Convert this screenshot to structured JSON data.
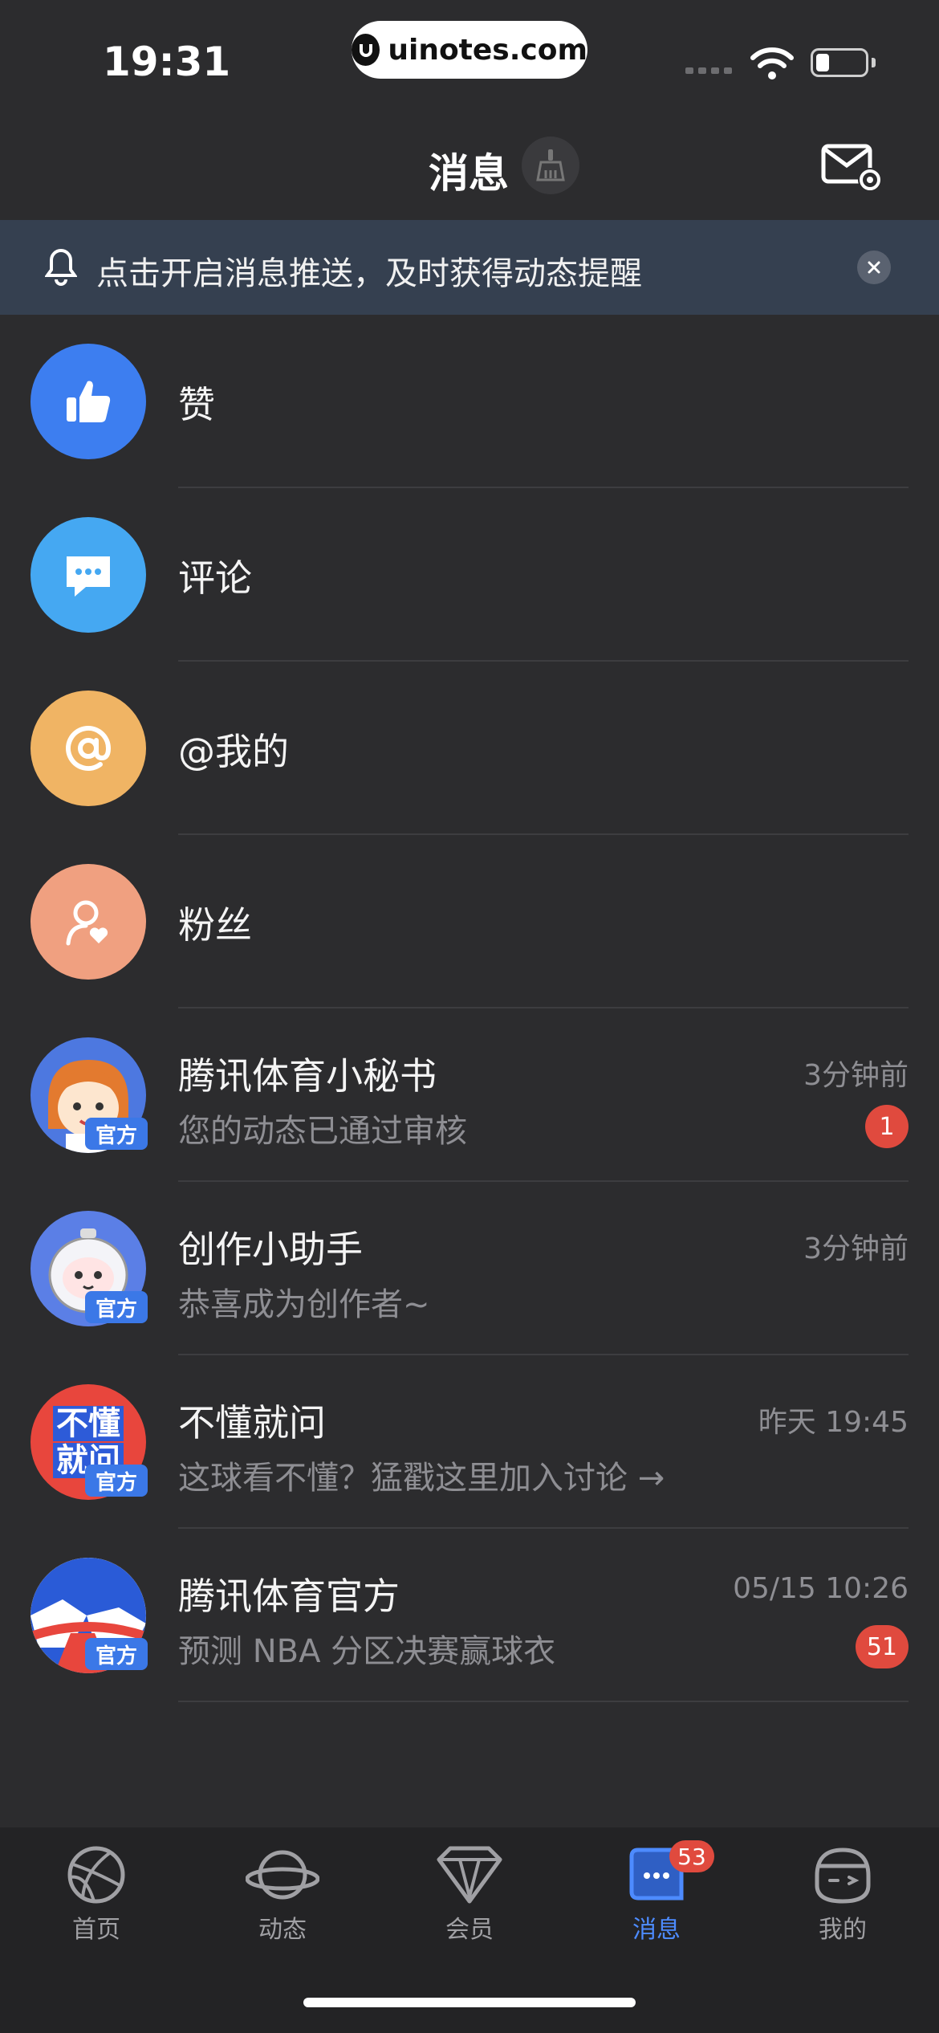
{
  "status_bar": {
    "time": "19:31",
    "url": "uinotes.com"
  },
  "header": {
    "title": "消息"
  },
  "banner": {
    "text": "点击开启消息推送，及时获得动态提醒"
  },
  "categories": [
    {
      "label": "赞",
      "icon": "thumbs-up-icon",
      "color": "#3d7ef0"
    },
    {
      "label": "评论",
      "icon": "comment-icon",
      "color": "#45a8f2"
    },
    {
      "label": "@我的",
      "icon": "at-icon",
      "color": "#f0b464"
    },
    {
      "label": "粉丝",
      "icon": "fans-icon",
      "color": "#f0a080"
    }
  ],
  "chats": [
    {
      "title": "腾讯体育小秘书",
      "preview": "您的动态已通过审核",
      "time": "3分钟前",
      "badge": "1",
      "tag": "官方"
    },
    {
      "title": "创作小助手",
      "preview": "恭喜成为创作者~",
      "time": "3分钟前",
      "badge": "",
      "tag": "官方"
    },
    {
      "title": "不懂就问",
      "preview": "这球看不懂？猛戳这里加入讨论 →",
      "time": "昨天 19:45",
      "badge": "",
      "tag": "官方",
      "avatar_text": [
        "不懂",
        "就问"
      ]
    },
    {
      "title": "腾讯体育官方",
      "preview": "预测 NBA 分区决赛赢球衣",
      "time": "05/15 10:26",
      "badge": "51",
      "tag": "官方"
    }
  ],
  "tabs": [
    {
      "label": "首页",
      "icon": "basketball-icon",
      "active": false
    },
    {
      "label": "动态",
      "icon": "planet-icon",
      "active": false
    },
    {
      "label": "会员",
      "icon": "diamond-icon",
      "active": false
    },
    {
      "label": "消息",
      "icon": "message-icon",
      "active": true,
      "badge": "53"
    },
    {
      "label": "我的",
      "icon": "profile-face-icon",
      "active": false
    }
  ],
  "colors": {
    "background": "#2c2c2e",
    "banner": "#354050",
    "accent": "#4d8bff",
    "badge": "#e04a3e"
  }
}
